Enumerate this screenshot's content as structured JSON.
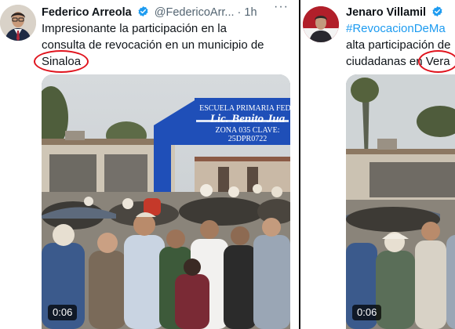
{
  "tweets": [
    {
      "author_name": "Federico Arreola",
      "handle": "@FedericoArr...",
      "separator": "·",
      "time": "1h",
      "more": "···",
      "text_lines": [
        "Impresionante la participación en la",
        "consulta de revocación en un municipio de"
      ],
      "highlighted_word": "Sinaloa",
      "media": {
        "sign_line1": "ESCUELA PRIMARIA FEDE",
        "sign_line2": "Lic. Benito Jua",
        "sign_line3": "ZONA 035   CLAVE: 25DPR0722",
        "duration": "0:06"
      }
    },
    {
      "author_name": "Jenaro Villamil",
      "hashtag": "#RevocacionDeMa",
      "text_line2": "alta participación de",
      "text_line3_prefix": "ciudadanas en ",
      "highlighted_word": "Vera",
      "media": {
        "duration": "0:06"
      }
    }
  ],
  "colors": {
    "verified": "#1d9bf0",
    "hashtag": "#1d9bf0",
    "highlight_circle": "#e0141e",
    "sign_blue": "#1f4fb8"
  },
  "icons": [
    "verified-badge-icon",
    "more-options-icon"
  ]
}
